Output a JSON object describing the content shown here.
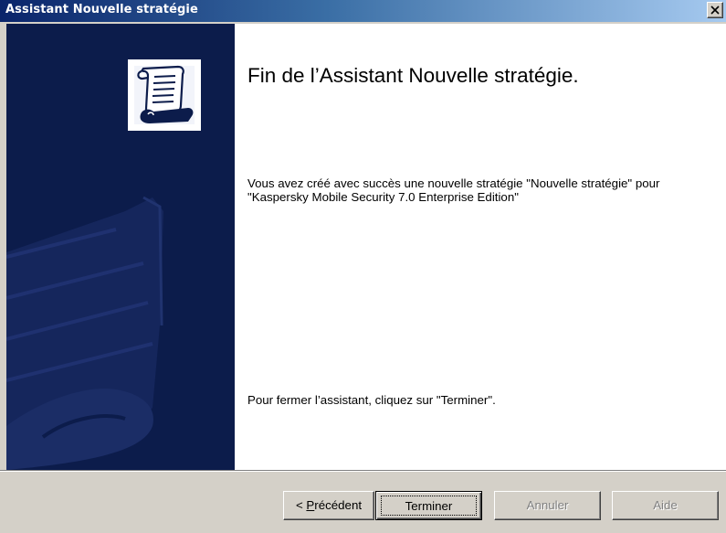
{
  "window": {
    "title": "Assistant Nouvelle stratégie",
    "close_label": "×"
  },
  "content": {
    "heading": "Fin de l’Assistant Nouvelle stratégie.",
    "message": "Vous avez créé avec succès une nouvelle stratégie \"Nouvelle stratégie\" pour \"Kaspersky Mobile Security 7.0 Enterprise Edition\"",
    "close_note": "Pour fermer l’assistant, cliquez sur \"Terminer\"."
  },
  "buttons": {
    "prev_prefix": "< ",
    "prev_accel": "P",
    "prev_rest": "récédent",
    "finish": "Terminer",
    "cancel": "Annuler",
    "help": "Aide"
  },
  "icons": {
    "banner": "scroll-document-icon",
    "close": "close-icon"
  },
  "colors": {
    "banner_bg": "#0c1c4b",
    "title_start": "#0a246a",
    "title_end": "#a6caf0",
    "dialog_bg": "#d4d0c8"
  }
}
